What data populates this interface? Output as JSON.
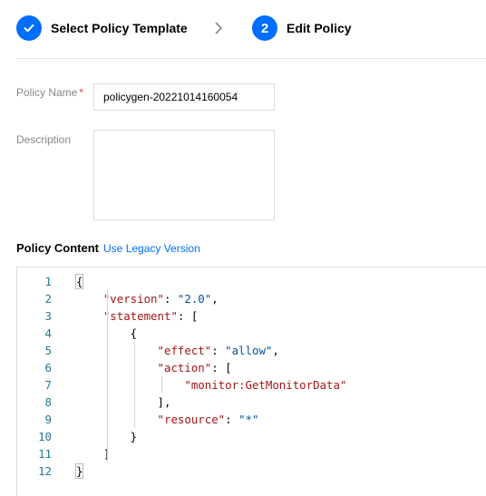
{
  "stepper": {
    "step1": {
      "label": "Select Policy Template",
      "icon": "check-icon"
    },
    "separator_icon": "chevron-right-icon",
    "step2": {
      "number": "2",
      "label": "Edit Policy"
    }
  },
  "form": {
    "policy_name": {
      "label": "Policy Name",
      "required_mark": "*",
      "value": "policygen-20221014160054"
    },
    "description": {
      "label": "Description",
      "value": ""
    }
  },
  "policy_content": {
    "title": "Policy Content",
    "legacy_link": "Use Legacy Version"
  },
  "editor": {
    "line_numbers": [
      "1",
      "2",
      "3",
      "4",
      "5",
      "6",
      "7",
      "8",
      "9",
      "10",
      "11",
      "12"
    ],
    "lines": [
      {
        "tokens": [
          {
            "text": "{",
            "type": "punct"
          }
        ]
      },
      {
        "tokens": [
          {
            "text": "    ",
            "type": "ws"
          },
          {
            "text": "\"version\"",
            "type": "key"
          },
          {
            "text": ": ",
            "type": "punct"
          },
          {
            "text": "\"2.0\"",
            "type": "val"
          },
          {
            "text": ",",
            "type": "punct"
          }
        ]
      },
      {
        "tokens": [
          {
            "text": "    ",
            "type": "ws"
          },
          {
            "text": "\"statement\"",
            "type": "key"
          },
          {
            "text": ": [",
            "type": "punct"
          }
        ]
      },
      {
        "tokens": [
          {
            "text": "        {",
            "type": "punct"
          }
        ]
      },
      {
        "tokens": [
          {
            "text": "            ",
            "type": "ws"
          },
          {
            "text": "\"effect\"",
            "type": "key"
          },
          {
            "text": ": ",
            "type": "punct"
          },
          {
            "text": "\"allow\"",
            "type": "val"
          },
          {
            "text": ",",
            "type": "punct"
          }
        ]
      },
      {
        "tokens": [
          {
            "text": "            ",
            "type": "ws"
          },
          {
            "text": "\"action\"",
            "type": "key"
          },
          {
            "text": ": [",
            "type": "punct"
          }
        ]
      },
      {
        "tokens": [
          {
            "text": "                ",
            "type": "ws"
          },
          {
            "text": "\"monitor:GetMonitorData\"",
            "type": "key"
          }
        ]
      },
      {
        "tokens": [
          {
            "text": "            ],",
            "type": "punct"
          }
        ]
      },
      {
        "tokens": [
          {
            "text": "            ",
            "type": "ws"
          },
          {
            "text": "\"resource\"",
            "type": "key"
          },
          {
            "text": ": ",
            "type": "punct"
          },
          {
            "text": "\"*\"",
            "type": "val"
          }
        ]
      },
      {
        "tokens": [
          {
            "text": "        }",
            "type": "punct"
          }
        ]
      },
      {
        "tokens": [
          {
            "text": "    ]",
            "type": "punct"
          }
        ]
      },
      {
        "tokens": [
          {
            "text": "}",
            "type": "punct"
          }
        ]
      }
    ]
  },
  "colors": {
    "accent": "#006eff",
    "required": "#e54545",
    "line_number": "#237893",
    "json_key": "#a31515",
    "json_value": "#0451a5"
  }
}
